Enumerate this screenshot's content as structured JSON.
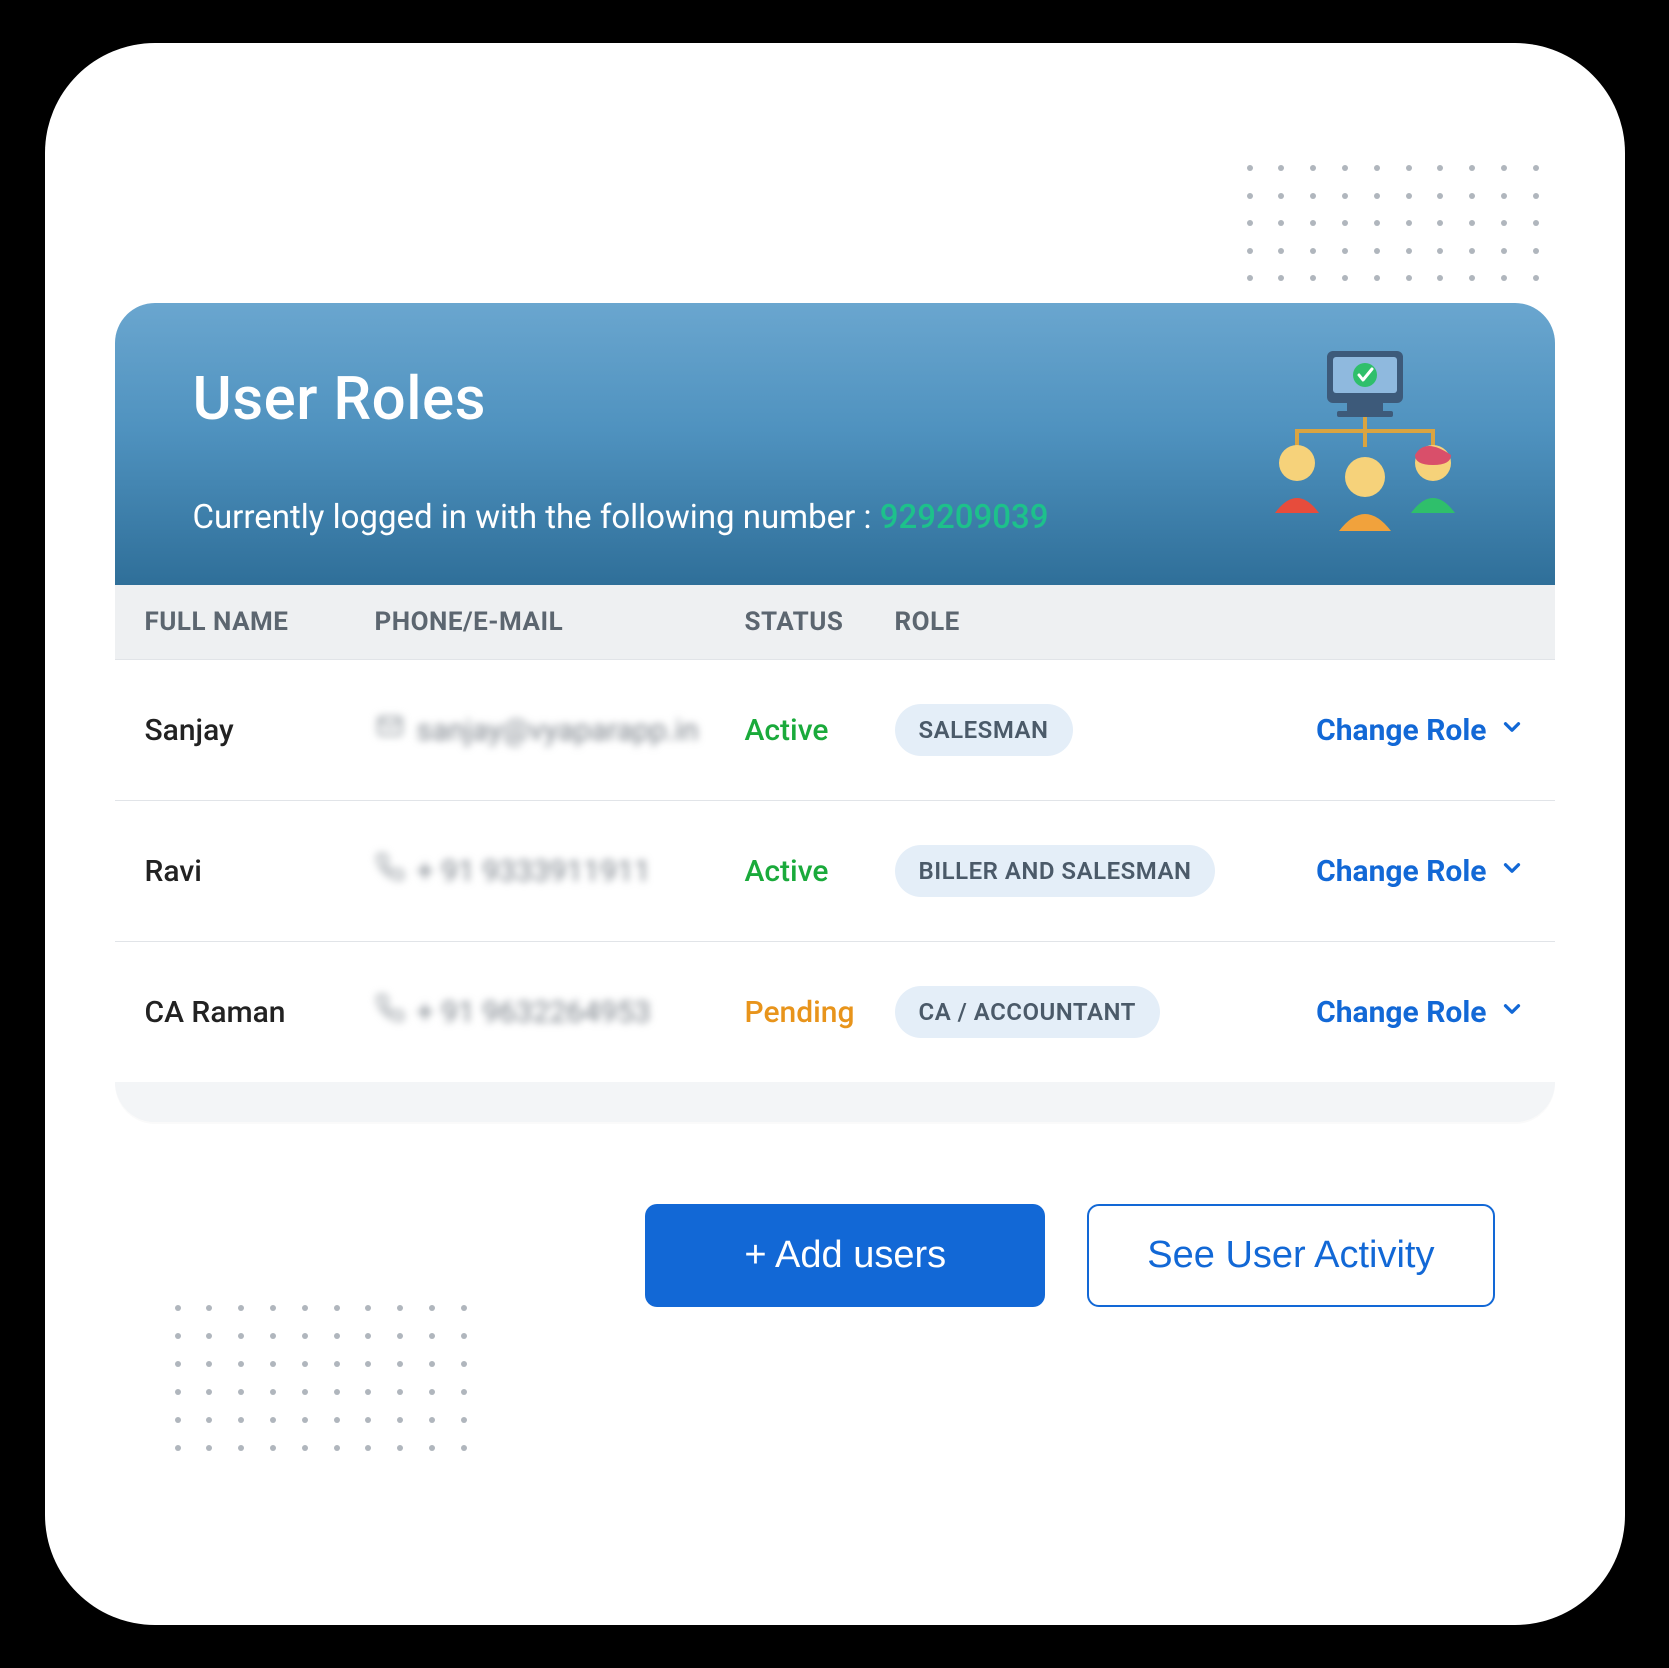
{
  "header": {
    "title": "User Roles",
    "subtitle_prefix": "Currently logged in with the following number : ",
    "login_number": "929209039"
  },
  "table": {
    "columns": {
      "name": "FULL NAME",
      "contact": "PHONE/E-MAIL",
      "status": "STATUS",
      "role": "ROLE"
    },
    "change_role_label": "Change Role",
    "rows": [
      {
        "name": "Sanjay",
        "contact_type": "email",
        "contact": "sanjay@vyaparapp.in",
        "status": "Active",
        "status_kind": "active",
        "role": "SALESMAN"
      },
      {
        "name": "Ravi",
        "contact_type": "phone",
        "contact": "+ 91 9333911911",
        "status": "Active",
        "status_kind": "active",
        "role": "BILLER AND SALESMAN"
      },
      {
        "name": "CA Raman",
        "contact_type": "phone",
        "contact": "+ 91 9632264953",
        "status": "Pending",
        "status_kind": "pending",
        "role": "CA / ACCOUNTANT"
      }
    ]
  },
  "actions": {
    "add_users": "+ Add users",
    "see_activity": "See User Activity"
  }
}
